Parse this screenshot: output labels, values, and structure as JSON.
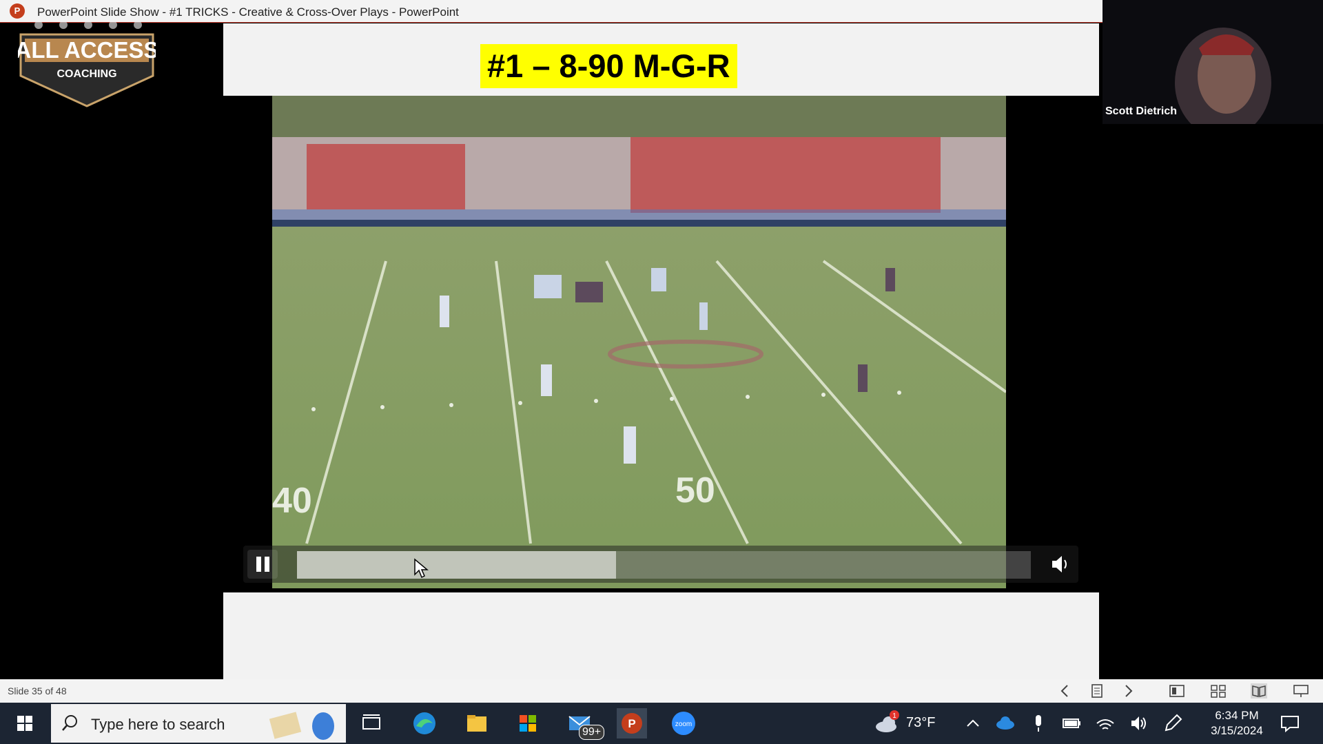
{
  "window": {
    "title": "PowerPoint Slide Show  -  #1 TRICKS - Creative & Cross-Over Plays - PowerPoint",
    "app_icon_letter": "P"
  },
  "slide": {
    "headline": "#1 – 8-90 M-G-R",
    "brand_top": "ALL ACCESS",
    "brand_bottom": "COACHING",
    "field_numbers": [
      "40",
      "50"
    ]
  },
  "video": {
    "progress": 0.435,
    "accent": "#ffff00"
  },
  "participant": {
    "name": "Scott Dietrich"
  },
  "statusbar": {
    "slide_counter": "Slide 35 of 48"
  },
  "taskbar": {
    "search_placeholder": "Type here to search",
    "mail_badge": "99+",
    "weather_badge": "1",
    "temperature": "73°F",
    "time": "6:34 PM",
    "date": "3/15/2024",
    "zoom_label": "zoom"
  },
  "icons": [
    "windows-start-icon",
    "search-icon",
    "task-view-icon",
    "edge-icon",
    "file-explorer-icon",
    "store-icon",
    "mail-icon",
    "powerpoint-icon",
    "zoom-icon",
    "weather-icon",
    "chevron-up-icon",
    "onedrive-icon",
    "microphone-icon",
    "battery-icon",
    "wifi-icon",
    "volume-icon",
    "pen-icon",
    "notification-icon",
    "pause-icon",
    "volume-icon",
    "prev-slide-icon",
    "next-slide-icon",
    "notes-icon",
    "normal-view-icon",
    "slide-sorter-icon",
    "reading-view-icon",
    "slideshow-icon"
  ]
}
